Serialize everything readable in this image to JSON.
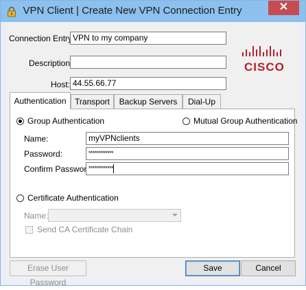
{
  "window": {
    "title": "VPN Client  |  Create New VPN Connection Entry",
    "close_glyph": "✕"
  },
  "form": {
    "connection_entry": {
      "label": "Connection Entry:",
      "value": "VPN to my company"
    },
    "description": {
      "label": "Description:",
      "value": ""
    },
    "host": {
      "label": "Host:",
      "value": "44.55.66.77"
    }
  },
  "logo": {
    "text": "CISCO",
    "color": "#b6202b"
  },
  "tabs": [
    {
      "label": "Authentication",
      "active": true
    },
    {
      "label": "Transport",
      "active": false
    },
    {
      "label": "Backup Servers",
      "active": false
    },
    {
      "label": "Dial-Up",
      "active": false
    }
  ],
  "auth": {
    "group_auth": {
      "label": "Group Authentication",
      "checked": true
    },
    "mutual_group_auth": {
      "label": "Mutual Group Authentication",
      "checked": false
    },
    "name": {
      "label": "Name:",
      "value": "myVPNclients"
    },
    "password": {
      "label": "Password:",
      "value": "************"
    },
    "confirm_password": {
      "label": "Confirm Password:",
      "value": "************"
    },
    "certificate_auth": {
      "label": "Certificate Authentication",
      "checked": false
    },
    "cert_name": {
      "label": "Name:",
      "value": ""
    },
    "send_ca_chain": {
      "label": "Send CA Certificate Chain",
      "checked": false
    }
  },
  "buttons": {
    "erase_password": "Erase User Password",
    "save": "Save",
    "cancel": "Cancel"
  },
  "colors": {
    "titlebar": "#8cc0ee",
    "close": "#c74b50",
    "dialog": "#f0f0f0"
  }
}
